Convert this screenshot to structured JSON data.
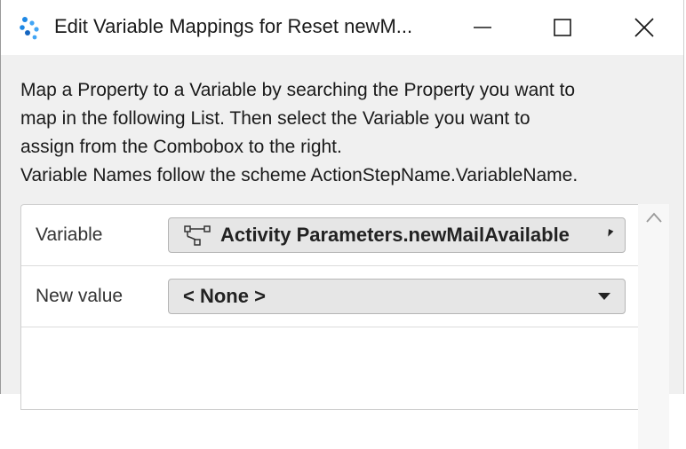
{
  "window": {
    "title": "Edit Variable Mappings for Reset newM...",
    "icon": "app-logo-icon",
    "controls": [
      "minimize-icon",
      "maximize-icon",
      "close-icon"
    ]
  },
  "description": {
    "lines": [
      "Map a Property to a Variable by searching the Property you want to",
      "map in the following List. Then select the Variable you want to",
      "assign from the Combobox to the right.",
      "Variable Names follow the scheme ActionStepName.VariableName."
    ]
  },
  "grid": {
    "rows": [
      {
        "label": "Variable",
        "value": "Activity Parameters.newMailAvailable",
        "icon": "variable-node-icon"
      },
      {
        "label": "New value",
        "value": "< None >"
      }
    ]
  },
  "scrollbar": {
    "up_icon": "chevron-up-icon"
  }
}
